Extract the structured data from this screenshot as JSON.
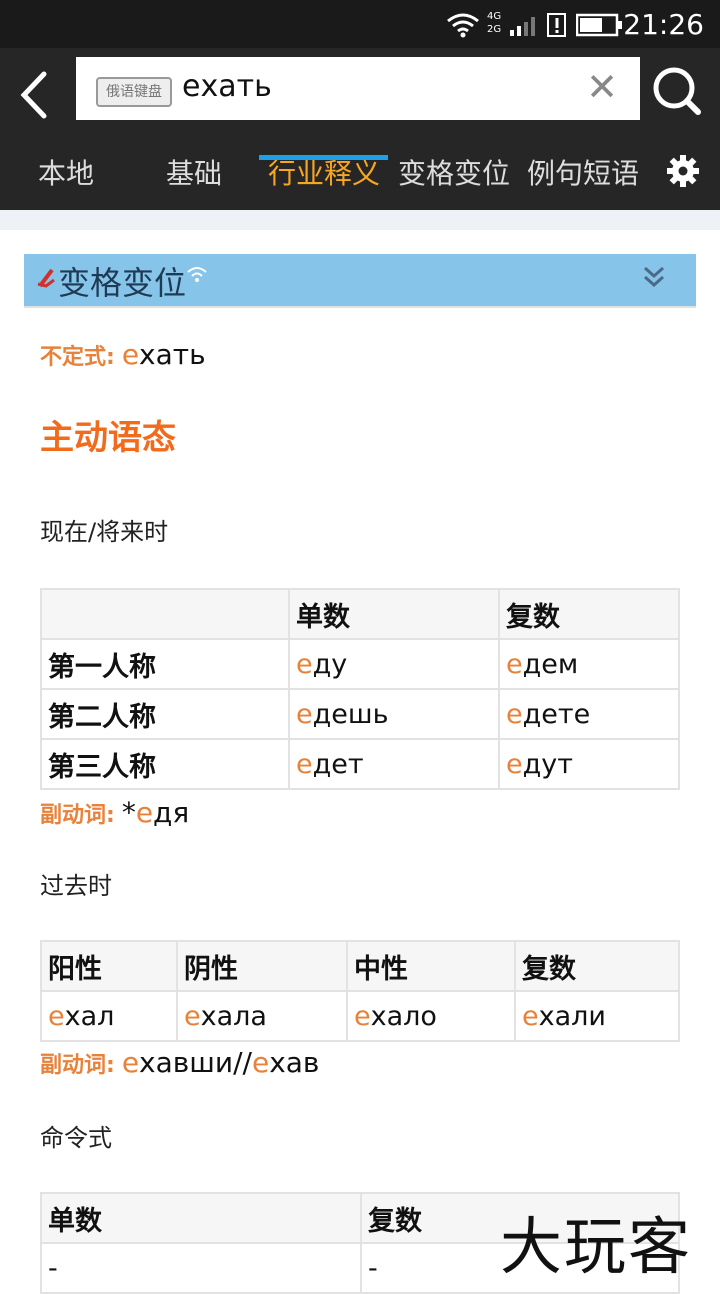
{
  "status": {
    "time": "21:26",
    "net1": "4G",
    "net2": "2G"
  },
  "search": {
    "keyboard_label": "俄语键盘",
    "query": "ехать",
    "clear": "✕"
  },
  "tabs": [
    {
      "label": "本地"
    },
    {
      "label": "基础"
    },
    {
      "label": "行业释义"
    },
    {
      "label": "变格变位"
    },
    {
      "label": "例句短语"
    }
  ],
  "active_tab": "行业释义",
  "section": {
    "title": "变格变位"
  },
  "infinitive": {
    "label": "不定式:",
    "hl": "е",
    "rest": "хать"
  },
  "voice": "主动语态",
  "present_future": {
    "title": "现在/将来时",
    "headers": [
      "",
      "单数",
      "复数"
    ],
    "rows": [
      {
        "person": "第一人称",
        "sg_hl": "е",
        "sg": "ду",
        "pl_hl": "е",
        "pl": "дем"
      },
      {
        "person": "第二人称",
        "sg_hl": "е",
        "sg": "дешь",
        "pl_hl": "е",
        "pl": "дете"
      },
      {
        "person": "第三人称",
        "sg_hl": "е",
        "sg": "дет",
        "pl_hl": "е",
        "pl": "дут"
      }
    ],
    "gerund_label": "副动词:",
    "gerund_prefix": "*",
    "gerund_hl": "е",
    "gerund_rest": "дя"
  },
  "past": {
    "title": "过去时",
    "headers": [
      "阳性",
      "阴性",
      "中性",
      "复数"
    ],
    "cells": [
      {
        "hl": "е",
        "rest": "хал"
      },
      {
        "hl": "е",
        "rest": "хала"
      },
      {
        "hl": "е",
        "rest": "хало"
      },
      {
        "hl": "е",
        "rest": "хали"
      }
    ],
    "gerund_label": "副动词:",
    "gerund_hl1": "е",
    "gerund_mid": "хавши//",
    "gerund_hl2": "е",
    "gerund_rest": "хав"
  },
  "imperative": {
    "title": "命令式",
    "headers": [
      "单数",
      "复数"
    ],
    "values": [
      "-",
      "-"
    ]
  },
  "watermark": "大玩客",
  "colors": {
    "accent": "#f5a623",
    "tab_underline": "#1ea0e6",
    "highlight": "#e8823a",
    "voice": "#f26a1b",
    "section_bg": "#87c4ea"
  }
}
